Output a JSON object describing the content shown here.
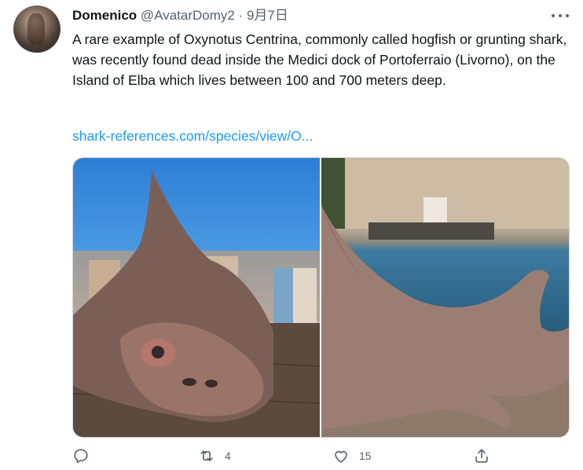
{
  "tweet": {
    "display_name": "Domenico",
    "handle": "@AvatarDomy2",
    "separator": " · ",
    "date": "9月7日",
    "text": "A rare example of Oxynotus Centrina, commonly called hogfish or grunting shark, was recently found dead inside the Medici dock of Portoferraio (Livorno), on the Island of Elba which lives between 100 and 700 meters deep.",
    "link": "shark-references.com/species/view/O..."
  },
  "media": {
    "photos": [
      {
        "subject": "grunting shark head with harbor buildings and blue sky"
      },
      {
        "subject": "grunting shark body on wooden dock by harbor water"
      }
    ]
  },
  "actions": {
    "reply_icon": "reply-icon",
    "retweet_icon": "retweet-icon",
    "retweet_count": "4",
    "like_icon": "heart-icon",
    "like_count": "15",
    "share_icon": "share-icon"
  }
}
